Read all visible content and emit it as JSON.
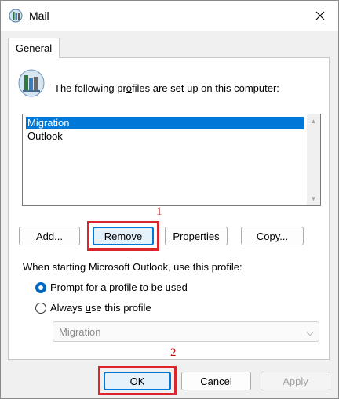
{
  "window": {
    "title": "Mail",
    "close_glyph": "✕"
  },
  "tabs": [
    {
      "label": "General"
    }
  ],
  "profiles": {
    "label_pre": "The following pr",
    "label_key": "o",
    "label_post": "files are set up on this computer:",
    "items": [
      "Migration",
      "Outlook"
    ],
    "selected_index": 0
  },
  "scrollbar": {
    "up_glyph": "▲",
    "down_glyph": "▼"
  },
  "buttons": {
    "add": {
      "pre": "A",
      "key": "d",
      "post": "d..."
    },
    "remove": {
      "pre": "",
      "key": "R",
      "post": "emove"
    },
    "properties": {
      "pre": "",
      "key": "P",
      "post": "roperties"
    },
    "copy": {
      "pre": "",
      "key": "C",
      "post": "opy..."
    },
    "ok": {
      "label": "OK"
    },
    "cancel": {
      "label": "Cancel"
    },
    "apply": {
      "pre": "",
      "key": "A",
      "post": "pply"
    }
  },
  "startup": {
    "label": "When starting Microsoft Outlook, use this profile:",
    "options": [
      {
        "pre": "",
        "key": "P",
        "post": "rompt for a profile to be used",
        "checked": true
      },
      {
        "pre": "Always ",
        "key": "u",
        "post": "se this profile",
        "checked": false
      }
    ],
    "select": {
      "value": "Migration",
      "arrow_glyph": "⌵"
    }
  },
  "annotations": [
    {
      "label": "1"
    },
    {
      "label": "2"
    }
  ],
  "colors": {
    "selection": "#0078d7",
    "annotation": "#d9252b",
    "focus": "#0078d7"
  },
  "icons": [
    "mail-app-icon",
    "close-icon",
    "profiles-icon",
    "scroll-up-icon",
    "scroll-down-icon",
    "chevron-down-icon"
  ]
}
